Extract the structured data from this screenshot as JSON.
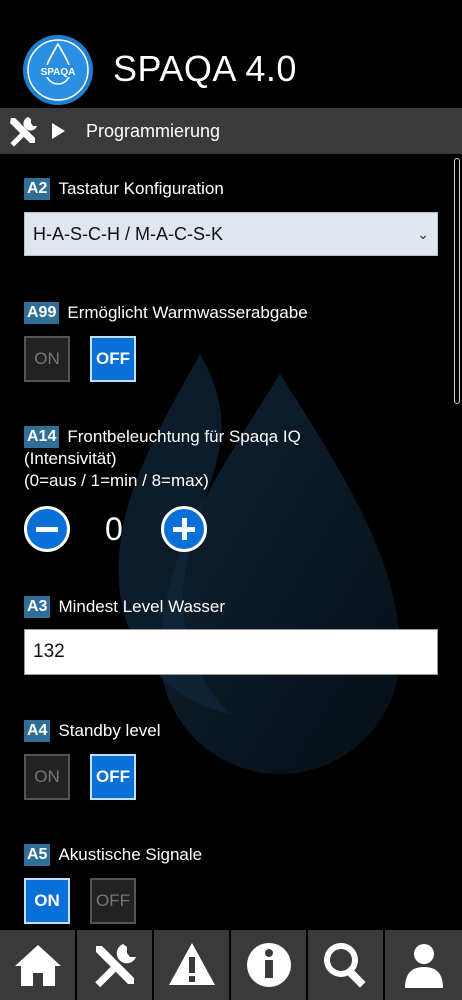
{
  "app": {
    "title": "SPAQA 4.0",
    "logo_text": "SPAQA"
  },
  "breadcrumb": {
    "label": "Programmierung"
  },
  "settings": {
    "a2": {
      "code": "A2",
      "title": "Tastatur Konfiguration",
      "selected": "H-A-S-C-H / M-A-C-S-K"
    },
    "a99": {
      "code": "A99",
      "title": "Ermöglicht Warmwasserabgabe",
      "on_label": "ON",
      "off_label": "OFF",
      "state": "OFF"
    },
    "a14": {
      "code": "A14",
      "title": "Frontbeleuchtung für Spaqa IQ",
      "desc1": "(Intensivität)",
      "desc2": "(0=aus / 1=min / 8=max)",
      "value": "0"
    },
    "a3": {
      "code": "A3",
      "title": "Mindest Level Wasser",
      "value": "132"
    },
    "a4": {
      "code": "A4",
      "title": "Standby level",
      "on_label": "ON",
      "off_label": "OFF",
      "state": "OFF"
    },
    "a5": {
      "code": "A5",
      "title": "Akustische Signale",
      "on_label": "ON",
      "off_label": "OFF",
      "state": "ON"
    }
  },
  "nav": [
    {
      "icon": "home-icon"
    },
    {
      "icon": "tools-icon"
    },
    {
      "icon": "warning-icon"
    },
    {
      "icon": "info-icon"
    },
    {
      "icon": "search-icon"
    },
    {
      "icon": "user-icon"
    }
  ],
  "colors": {
    "accent": "#0a6fd6",
    "badge": "#2f6f97",
    "bar": "#3a3a3a"
  }
}
